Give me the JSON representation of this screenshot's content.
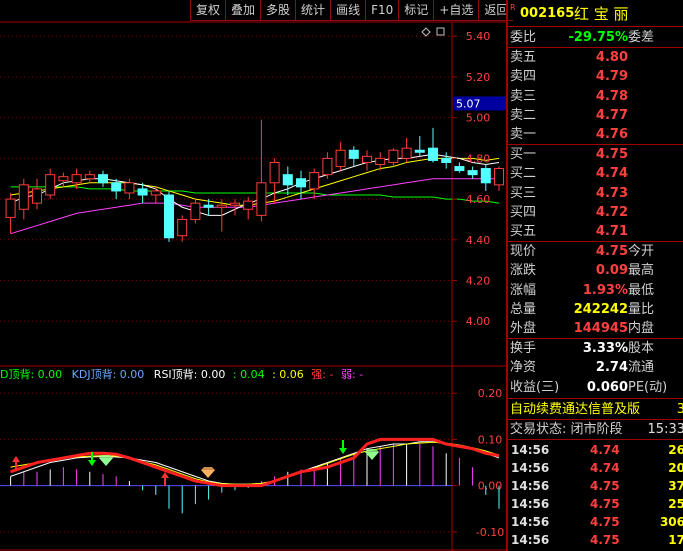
{
  "toolbar": [
    "复权",
    "叠加",
    "多股",
    "统计",
    "画线",
    "F10",
    "标记",
    "+自选",
    "返回"
  ],
  "price_axis": [
    "5.40",
    "5.20",
    "5.00",
    "4.80",
    "4.60",
    "4.40",
    "4.20",
    "4.00"
  ],
  "price_marker": "5.07",
  "ind_axis": [
    "0.20",
    "0.10",
    "0.00",
    "-0.10"
  ],
  "indicator_legend": {
    "d_label": "D顶背: 0.00",
    "kdj_label": "KDJ顶背: 0.00",
    "rsi_label": "RSI顶背: 0.00",
    "v1": ": 0.04",
    "v2": ": 0.06",
    "strong": "强: -",
    "weak": "弱: -"
  },
  "colors": {
    "up": "#ff3c3c",
    "down": "#54ffff",
    "ma5": "#ffffff",
    "ma10": "#ffff00",
    "ma20": "#ff40ff",
    "ma60": "#00ff00",
    "border": "#a00000"
  },
  "stock": {
    "code": "002165",
    "name": "红 宝 丽",
    "badge": "R"
  },
  "ratio": {
    "label": "委比",
    "value": "-29.75%",
    "label2": "委差"
  },
  "asks": [
    {
      "label": "卖五",
      "price": "4.80"
    },
    {
      "label": "卖四",
      "price": "4.79"
    },
    {
      "label": "卖三",
      "price": "4.78"
    },
    {
      "label": "卖二",
      "price": "4.77"
    },
    {
      "label": "卖一",
      "price": "4.76"
    }
  ],
  "bids": [
    {
      "label": "买一",
      "price": "4.75"
    },
    {
      "label": "买二",
      "price": "4.74"
    },
    {
      "label": "买三",
      "price": "4.73"
    },
    {
      "label": "买四",
      "price": "4.72"
    },
    {
      "label": "买五",
      "price": "4.71"
    }
  ],
  "stats1": [
    {
      "label": "现价",
      "value": "4.75",
      "label2": "今开"
    },
    {
      "label": "涨跌",
      "value": "0.09",
      "label2": "最高"
    },
    {
      "label": "涨幅",
      "value": "1.93%",
      "label2": "最低"
    },
    {
      "label": "总量",
      "value": "242242",
      "label2": "量比"
    },
    {
      "label": "外盘",
      "value": "144945",
      "label2": "内盘"
    }
  ],
  "stats2": [
    {
      "label": "换手",
      "value": "3.33%",
      "label2": "股本"
    },
    {
      "label": "净资",
      "value": "2.74",
      "label2": "流通"
    },
    {
      "label": "收益(三)",
      "value": "0.060",
      "label2": "PE(动)"
    }
  ],
  "ad_text": "自动续费通达信普及版",
  "ad_num": "3",
  "trade_status": "交易状态: 闭市阶段",
  "trade_time": "15:33",
  "ticks": [
    {
      "time": "14:56",
      "price": "4.74",
      "vol": "26"
    },
    {
      "time": "14:56",
      "price": "4.74",
      "vol": "20"
    },
    {
      "time": "14:56",
      "price": "4.75",
      "vol": "37"
    },
    {
      "time": "14:56",
      "price": "4.75",
      "vol": "25"
    },
    {
      "time": "14:56",
      "price": "4.75",
      "vol": "306"
    },
    {
      "time": "14:56",
      "price": "4.75",
      "vol": "17"
    }
  ],
  "chart_data": {
    "type": "candlestick",
    "price_range": [
      3.78,
      5.47
    ],
    "candles": [
      {
        "o": 4.51,
        "c": 4.6,
        "h": 4.63,
        "l": 4.43
      },
      {
        "o": 4.55,
        "c": 4.67,
        "h": 4.7,
        "l": 4.5
      },
      {
        "o": 4.58,
        "c": 4.65,
        "h": 4.7,
        "l": 4.55
      },
      {
        "o": 4.62,
        "c": 4.72,
        "h": 4.75,
        "l": 4.6
      },
      {
        "o": 4.69,
        "c": 4.71,
        "h": 4.73,
        "l": 4.66
      },
      {
        "o": 4.68,
        "c": 4.72,
        "h": 4.75,
        "l": 4.65
      },
      {
        "o": 4.7,
        "c": 4.72,
        "h": 4.74,
        "l": 4.68
      },
      {
        "o": 4.72,
        "c": 4.68,
        "h": 4.74,
        "l": 4.66
      },
      {
        "o": 4.68,
        "c": 4.64,
        "h": 4.7,
        "l": 4.6
      },
      {
        "o": 4.63,
        "c": 4.68,
        "h": 4.7,
        "l": 4.6
      },
      {
        "o": 4.65,
        "c": 4.62,
        "h": 4.68,
        "l": 4.58
      },
      {
        "o": 4.62,
        "c": 4.64,
        "h": 4.66,
        "l": 4.58
      },
      {
        "o": 4.62,
        "c": 4.41,
        "h": 4.64,
        "l": 4.39
      },
      {
        "o": 4.42,
        "c": 4.5,
        "h": 4.52,
        "l": 4.39
      },
      {
        "o": 4.5,
        "c": 4.58,
        "h": 4.6,
        "l": 4.48
      },
      {
        "o": 4.57,
        "c": 4.56,
        "h": 4.6,
        "l": 4.52
      },
      {
        "o": 4.56,
        "c": 4.57,
        "h": 4.6,
        "l": 4.44
      },
      {
        "o": 4.57,
        "c": 4.58,
        "h": 4.6,
        "l": 4.52
      },
      {
        "o": 4.55,
        "c": 4.59,
        "h": 4.61,
        "l": 4.5
      },
      {
        "o": 4.52,
        "c": 4.68,
        "h": 4.99,
        "l": 4.49
      },
      {
        "o": 4.68,
        "c": 4.78,
        "h": 4.8,
        "l": 4.58
      },
      {
        "o": 4.72,
        "c": 4.67,
        "h": 4.76,
        "l": 4.62
      },
      {
        "o": 4.7,
        "c": 4.66,
        "h": 4.74,
        "l": 4.6
      },
      {
        "o": 4.65,
        "c": 4.73,
        "h": 4.75,
        "l": 4.6
      },
      {
        "o": 4.72,
        "c": 4.8,
        "h": 4.83,
        "l": 4.7
      },
      {
        "o": 4.76,
        "c": 4.84,
        "h": 4.88,
        "l": 4.74
      },
      {
        "o": 4.84,
        "c": 4.8,
        "h": 4.86,
        "l": 4.76
      },
      {
        "o": 4.78,
        "c": 4.81,
        "h": 4.84,
        "l": 4.74
      },
      {
        "o": 4.77,
        "c": 4.8,
        "h": 4.83,
        "l": 4.74
      },
      {
        "o": 4.78,
        "c": 4.84,
        "h": 4.85,
        "l": 4.76
      },
      {
        "o": 4.8,
        "c": 4.85,
        "h": 4.9,
        "l": 4.78
      },
      {
        "o": 4.84,
        "c": 4.83,
        "h": 4.91,
        "l": 4.81
      },
      {
        "o": 4.85,
        "c": 4.79,
        "h": 4.95,
        "l": 4.78
      },
      {
        "o": 4.8,
        "c": 4.78,
        "h": 4.83,
        "l": 4.75
      },
      {
        "o": 4.76,
        "c": 4.74,
        "h": 4.78,
        "l": 4.73
      },
      {
        "o": 4.74,
        "c": 4.72,
        "h": 4.76,
        "l": 4.7
      },
      {
        "o": 4.75,
        "c": 4.68,
        "h": 4.77,
        "l": 4.64
      },
      {
        "o": 4.67,
        "c": 4.75,
        "h": 4.76,
        "l": 4.64
      }
    ],
    "ma5": [
      4.58,
      4.61,
      4.62,
      4.65,
      4.68,
      4.69,
      4.7,
      4.7,
      4.69,
      4.68,
      4.67,
      4.65,
      4.6,
      4.56,
      4.54,
      4.52,
      4.52,
      4.55,
      4.58,
      4.6,
      4.63,
      4.65,
      4.68,
      4.7,
      4.72,
      4.74,
      4.76,
      4.78,
      4.79,
      4.8,
      4.8,
      4.81,
      4.82,
      4.81,
      4.8,
      4.78,
      4.77,
      4.78
    ],
    "ma10": [
      4.62,
      4.63,
      4.64,
      4.65,
      4.66,
      4.67,
      4.68,
      4.68,
      4.68,
      4.68,
      4.67,
      4.66,
      4.64,
      4.62,
      4.6,
      4.59,
      4.58,
      4.57,
      4.57,
      4.58,
      4.59,
      4.61,
      4.63,
      4.65,
      4.67,
      4.69,
      4.71,
      4.73,
      4.75,
      4.76,
      4.78,
      4.79,
      4.8,
      4.8,
      4.8,
      4.8,
      4.79,
      4.8
    ],
    "ma20": [
      4.43,
      4.45,
      4.47,
      4.49,
      4.51,
      4.53,
      4.54,
      4.55,
      4.56,
      4.57,
      4.58,
      4.58,
      4.58,
      4.57,
      4.56,
      4.56,
      4.56,
      4.56,
      4.56,
      4.57,
      4.58,
      4.59,
      4.6,
      4.61,
      4.62,
      4.63,
      4.64,
      4.65,
      4.66,
      4.67,
      4.68,
      4.69,
      4.7,
      4.7,
      4.7,
      4.7,
      4.7,
      4.7
    ],
    "ma60": [
      4.66,
      4.66,
      4.66,
      4.66,
      4.66,
      4.66,
      4.65,
      4.65,
      4.65,
      4.64,
      4.64,
      4.64,
      4.64,
      4.64,
      4.63,
      4.63,
      4.63,
      4.63,
      4.63,
      4.63,
      4.63,
      4.63,
      4.63,
      4.63,
      4.62,
      4.62,
      4.62,
      4.62,
      4.62,
      4.61,
      4.61,
      4.61,
      4.61,
      4.6,
      4.6,
      4.59,
      4.59,
      4.58
    ],
    "indicator": {
      "range": [
        -0.135,
        0.22
      ],
      "red_line": [
        0.03,
        0.04,
        0.05,
        0.055,
        0.06,
        0.065,
        0.07,
        0.07,
        0.068,
        0.06,
        0.05,
        0.04,
        0.03,
        0.02,
        0.01,
        0.005,
        0.0,
        0.0,
        0.0,
        0.0,
        0.01,
        0.02,
        0.03,
        0.035,
        0.04,
        0.05,
        0.06,
        0.09,
        0.1,
        0.1,
        0.1,
        0.1,
        0.1,
        0.09,
        0.085,
        0.08,
        0.07,
        0.065
      ],
      "white_line": [
        0.02,
        0.03,
        0.04,
        0.05,
        0.055,
        0.06,
        0.062,
        0.063,
        0.062,
        0.06,
        0.055,
        0.05,
        0.04,
        0.03,
        0.02,
        0.01,
        0.005,
        0.003,
        0.003,
        0.005,
        0.01,
        0.02,
        0.03,
        0.04,
        0.05,
        0.06,
        0.07,
        0.08,
        0.085,
        0.09,
        0.09,
        0.095,
        0.095,
        0.09,
        0.085,
        0.08,
        0.07,
        0.06
      ],
      "yellow_line": [
        0.04,
        0.045,
        0.05,
        0.055,
        0.06,
        0.062,
        0.064,
        0.065,
        0.064,
        0.06,
        0.052,
        0.045,
        0.035,
        0.025,
        0.015,
        0.008,
        0.004,
        0.003,
        0.003,
        0.005,
        0.01,
        0.018,
        0.028,
        0.038,
        0.048,
        0.058,
        0.068,
        0.075,
        0.08,
        0.085,
        0.09,
        0.092,
        0.094,
        0.092,
        0.088,
        0.082,
        0.075,
        0.066
      ],
      "bars": [
        0.02,
        0.03,
        0.03,
        0.035,
        0.04,
        0.035,
        0.03,
        0.025,
        0.02,
        0.01,
        -0.01,
        -0.02,
        -0.05,
        -0.06,
        -0.04,
        -0.03,
        -0.015,
        -0.01,
        -0.005,
        0.01,
        0.02,
        0.03,
        0.035,
        0.04,
        0.05,
        0.06,
        0.07,
        0.08,
        0.085,
        0.09,
        0.09,
        0.09,
        0.085,
        0.07,
        0.06,
        0.04,
        -0.02,
        -0.05
      ]
    }
  }
}
